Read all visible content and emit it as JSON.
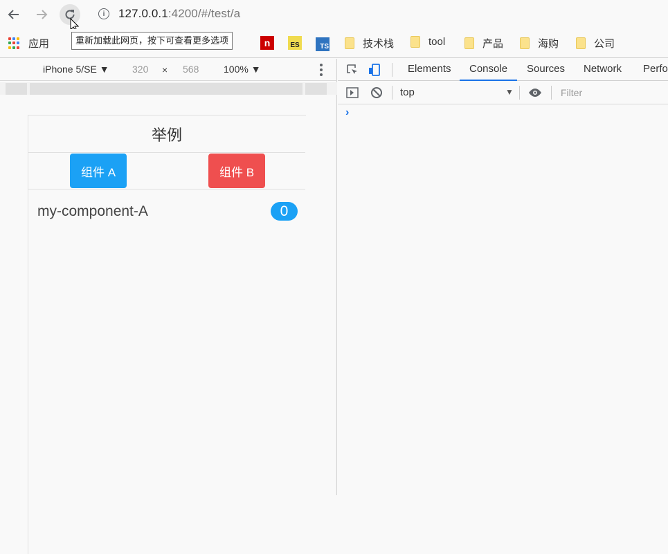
{
  "browser": {
    "url_host": "127.0.0.1",
    "url_rest": ":4200/#/test/a",
    "reload_tooltip": "重新加载此网页，按下可查看更多选项"
  },
  "bookmarks": {
    "apps_label": "应用",
    "items": [
      {
        "label": "技术栈"
      },
      {
        "label": "tool"
      },
      {
        "label": "产品"
      },
      {
        "label": "海购"
      },
      {
        "label": "公司"
      }
    ],
    "es_badge": "ES",
    "ts_badge": "TS",
    "n_badge": "n"
  },
  "device_toolbar": {
    "device": "iPhone 5/SE ▼",
    "width": "320",
    "height": "568",
    "times": "×",
    "zoom": "100% ▼"
  },
  "page": {
    "title": "举例",
    "button_a": "组件 A",
    "button_b": "组件 B",
    "component_label": "my-component-A",
    "count": "0"
  },
  "devtools": {
    "tabs": [
      "Elements",
      "Console",
      "Sources",
      "Network",
      "Perfo"
    ],
    "active_tab": "Console",
    "context": "top",
    "filter_placeholder": "Filter",
    "prompt": "›"
  },
  "colors": {
    "accent_blue": "#1ba1f5",
    "accent_red": "#ef4f4f",
    "devtools_active": "#1a73e8"
  }
}
